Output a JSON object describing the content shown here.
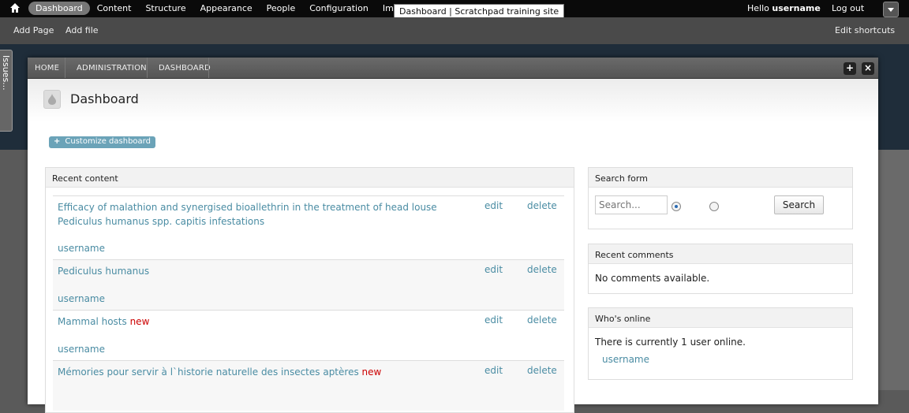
{
  "toolbar": {
    "menu": [
      "Dashboard",
      "Content",
      "Structure",
      "Appearance",
      "People",
      "Configuration",
      "Im"
    ],
    "hello": "Hello",
    "username": "username",
    "logout": "Log out"
  },
  "tooltip": "Dashboard | Scratchpad training site",
  "shortcuts": {
    "add_page": "Add Page",
    "add_file": "Add file",
    "edit": "Edit shortcuts"
  },
  "issues_tab": "Issues...",
  "breadcrumb": [
    "HOME",
    "ADMINISTRATION",
    "DASHBOARD"
  ],
  "controls": {
    "expand": "+",
    "close": "×"
  },
  "page_title": "Dashboard",
  "customize": {
    "plus": "+",
    "label": "Customize dashboard"
  },
  "recent_content": {
    "heading": "Recent content",
    "edit": "edit",
    "delete": "delete",
    "new_marker": "new",
    "rows": [
      {
        "title": "Efficacy of malathion and synergised bioallethrin in the treatment of head louse Pediculus humanus spp. capitis infestations",
        "user": "username",
        "is_new": false
      },
      {
        "title": "Pediculus humanus",
        "user": "username",
        "is_new": false
      },
      {
        "title": "Mammal hosts",
        "user": "username",
        "is_new": true
      },
      {
        "title": "Mémories pour servir à l`historie naturelle des insectes aptères",
        "user": "",
        "is_new": true
      }
    ]
  },
  "search_form": {
    "heading": "Search form",
    "placeholder": "Search...",
    "button": "Search"
  },
  "recent_comments": {
    "heading": "Recent comments",
    "text": "No comments available."
  },
  "whos_online": {
    "heading": "Who's online",
    "text": "There is currently 1 user online.",
    "user": "username"
  },
  "colors": {
    "link": "#4a8ca3",
    "new": "#cc0000",
    "toolbar": "#0a0a0a",
    "active_tab": "#777777",
    "customize": "#6ba3b8"
  }
}
